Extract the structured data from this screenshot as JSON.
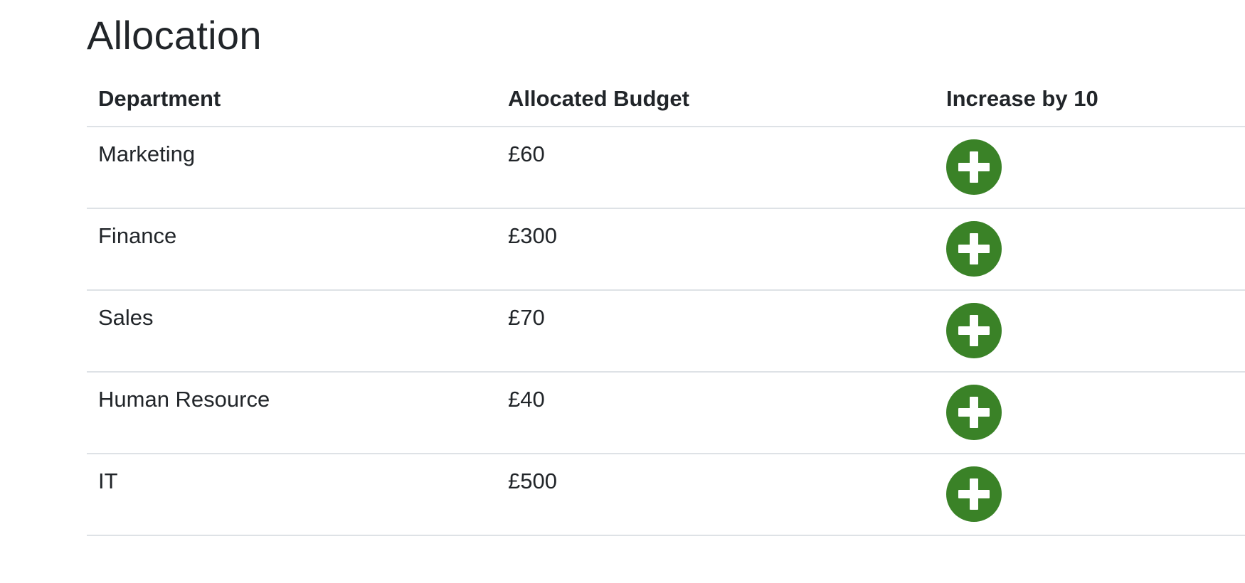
{
  "page": {
    "title": "Allocation"
  },
  "table": {
    "headers": [
      "Department",
      "Allocated Budget",
      "Increase by 10"
    ],
    "rows": [
      {
        "department": "Marketing",
        "budget": "£60"
      },
      {
        "department": "Finance",
        "budget": "£300"
      },
      {
        "department": "Sales",
        "budget": "£70"
      },
      {
        "department": "Human Resource",
        "budget": "£40"
      },
      {
        "department": "IT",
        "budget": "£500"
      }
    ],
    "action_icon": "plus-circle-icon"
  },
  "colors": {
    "text": "#212529",
    "divider": "#dee2e6",
    "action_button": "#3a8227",
    "action_icon": "#ffffff"
  }
}
